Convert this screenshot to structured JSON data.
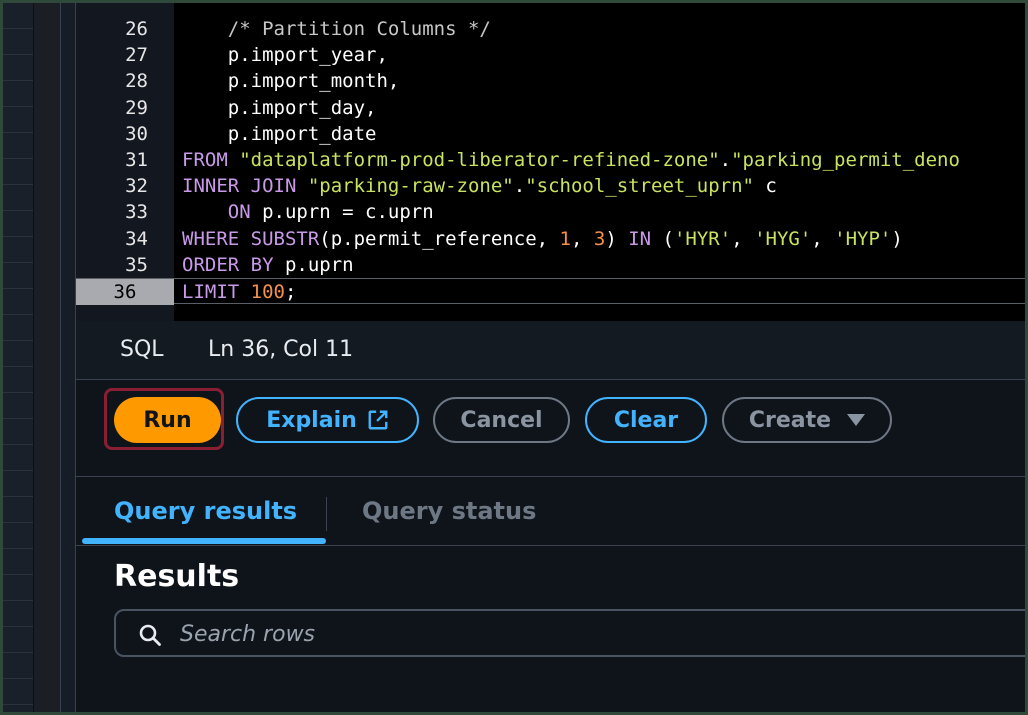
{
  "editor": {
    "lines": [
      {
        "n": "26",
        "tokens": [
          {
            "t": "    /* Partition Columns */",
            "c": "cm"
          }
        ]
      },
      {
        "n": "27",
        "tokens": [
          {
            "t": "    p.import_year,",
            "c": ""
          }
        ]
      },
      {
        "n": "28",
        "tokens": [
          {
            "t": "    p.import_month,",
            "c": ""
          }
        ]
      },
      {
        "n": "29",
        "tokens": [
          {
            "t": "    p.import_day,",
            "c": ""
          }
        ]
      },
      {
        "n": "30",
        "tokens": [
          {
            "t": "    p.import_date",
            "c": ""
          }
        ]
      },
      {
        "n": "31",
        "tokens": [
          {
            "t": "FROM",
            "c": "kw"
          },
          {
            "t": " ",
            "c": ""
          },
          {
            "t": "\"dataplatform-prod-liberator-refined-zone\"",
            "c": "str"
          },
          {
            "t": ".",
            "c": ""
          },
          {
            "t": "\"parking_permit_deno",
            "c": "str"
          }
        ]
      },
      {
        "n": "32",
        "tokens": [
          {
            "t": "INNER JOIN",
            "c": "kw"
          },
          {
            "t": " ",
            "c": ""
          },
          {
            "t": "\"parking-raw-zone\"",
            "c": "str"
          },
          {
            "t": ".",
            "c": ""
          },
          {
            "t": "\"school_street_uprn\"",
            "c": "str"
          },
          {
            "t": " c",
            "c": ""
          }
        ]
      },
      {
        "n": "33",
        "tokens": [
          {
            "t": "    ",
            "c": ""
          },
          {
            "t": "ON",
            "c": "kw"
          },
          {
            "t": " p.uprn = c.uprn",
            "c": ""
          }
        ]
      },
      {
        "n": "34",
        "tokens": [
          {
            "t": "WHERE",
            "c": "kw"
          },
          {
            "t": " ",
            "c": ""
          },
          {
            "t": "SUBSTR",
            "c": "fn"
          },
          {
            "t": "(p.permit_reference, ",
            "c": ""
          },
          {
            "t": "1",
            "c": "num"
          },
          {
            "t": ", ",
            "c": ""
          },
          {
            "t": "3",
            "c": "num"
          },
          {
            "t": ") ",
            "c": ""
          },
          {
            "t": "IN",
            "c": "kw"
          },
          {
            "t": " (",
            "c": ""
          },
          {
            "t": "'HYR'",
            "c": "str"
          },
          {
            "t": ", ",
            "c": ""
          },
          {
            "t": "'HYG'",
            "c": "str"
          },
          {
            "t": ", ",
            "c": ""
          },
          {
            "t": "'HYP'",
            "c": "str"
          },
          {
            "t": ")",
            "c": ""
          }
        ]
      },
      {
        "n": "35",
        "tokens": [
          {
            "t": "ORDER BY",
            "c": "kw"
          },
          {
            "t": " p.uprn",
            "c": ""
          }
        ]
      },
      {
        "n": "36",
        "active": true,
        "tokens": [
          {
            "t": "LIMIT",
            "c": "kw"
          },
          {
            "t": " ",
            "c": ""
          },
          {
            "t": "100",
            "c": "num"
          },
          {
            "t": ";",
            "c": ""
          }
        ]
      }
    ]
  },
  "statusbar": {
    "language": "SQL",
    "position": "Ln 36, Col 11"
  },
  "toolbar": {
    "run": "Run",
    "explain": "Explain",
    "cancel": "Cancel",
    "clear": "Clear",
    "create": "Create"
  },
  "tabs": {
    "results": "Query results",
    "status": "Query status"
  },
  "results": {
    "title": "Results",
    "search_placeholder": "Search rows"
  },
  "colors": {
    "accent": "#ff9900",
    "link": "#42b4ff",
    "highlight_border": "#8a1f33"
  }
}
